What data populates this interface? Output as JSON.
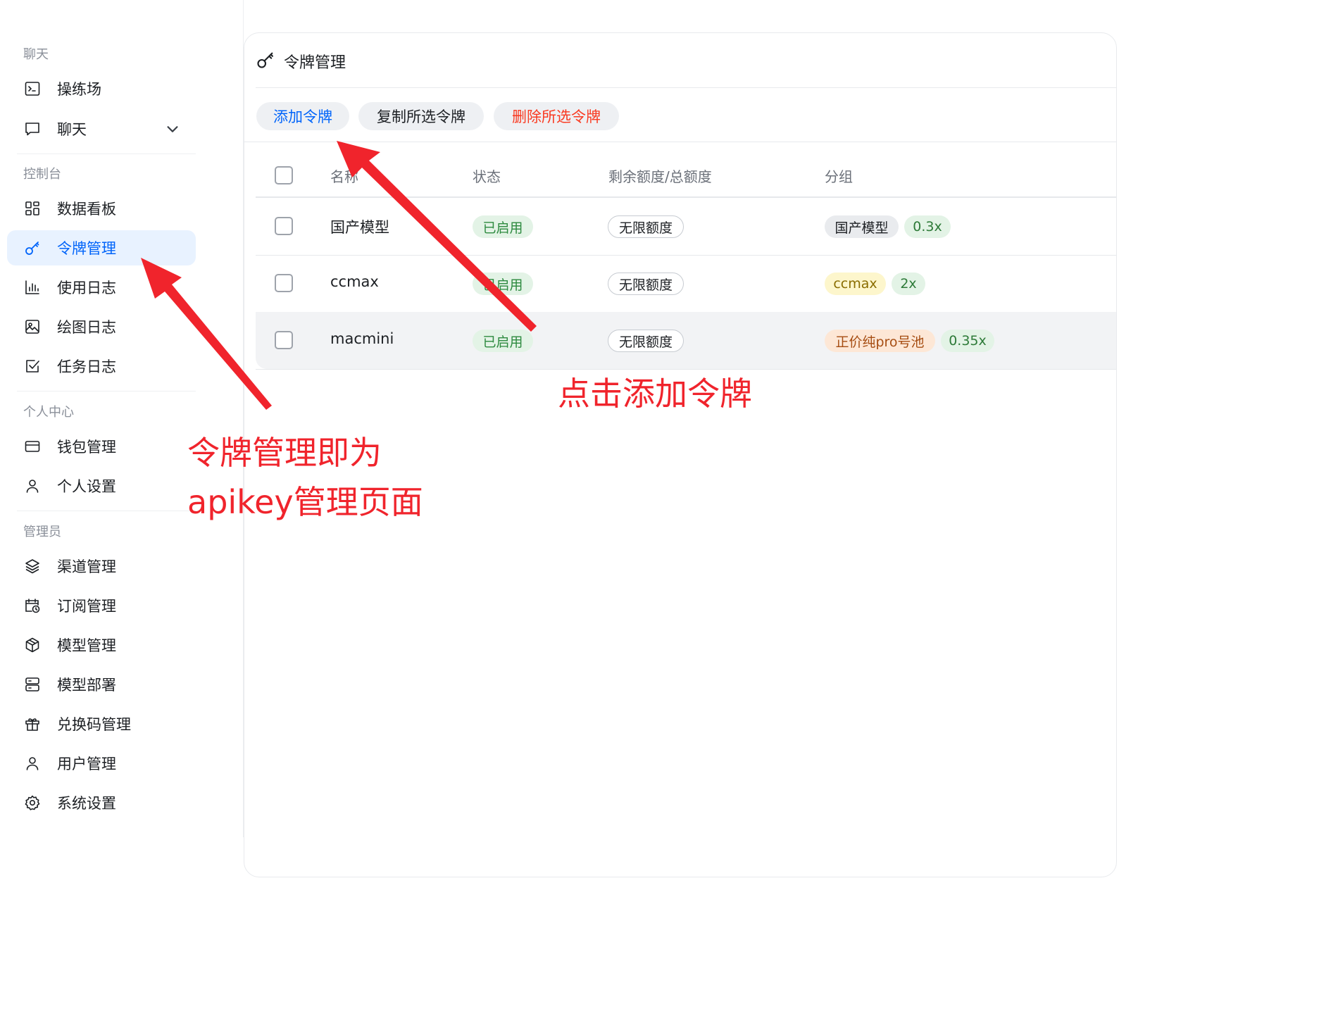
{
  "sidebar": {
    "sections": [
      {
        "label": "聊天"
      },
      {
        "label": "控制台"
      },
      {
        "label": "个人中心"
      },
      {
        "label": "管理员"
      }
    ],
    "items": {
      "playground": {
        "label": "操练场",
        "icon": "terminal-icon"
      },
      "chat": {
        "label": "聊天",
        "icon": "chat-bubble-icon"
      },
      "dashboard": {
        "label": "数据看板",
        "icon": "grid-icon"
      },
      "tokens": {
        "label": "令牌管理",
        "icon": "key-icon",
        "active": true
      },
      "usage_log": {
        "label": "使用日志",
        "icon": "bar-chart-icon"
      },
      "draw_log": {
        "label": "绘图日志",
        "icon": "image-icon"
      },
      "task_log": {
        "label": "任务日志",
        "icon": "checkbox-icon"
      },
      "wallet": {
        "label": "钱包管理",
        "icon": "credit-card-icon"
      },
      "profile": {
        "label": "个人设置",
        "icon": "user-icon"
      },
      "channels": {
        "label": "渠道管理",
        "icon": "layers-icon"
      },
      "subscriptions": {
        "label": "订阅管理",
        "icon": "calendar-icon"
      },
      "models": {
        "label": "模型管理",
        "icon": "cube-icon"
      },
      "deploy": {
        "label": "模型部署",
        "icon": "server-icon"
      },
      "redeem": {
        "label": "兑换码管理",
        "icon": "gift-icon"
      },
      "users": {
        "label": "用户管理",
        "icon": "user-icon"
      },
      "settings": {
        "label": "系统设置",
        "icon": "gear-icon"
      }
    }
  },
  "card": {
    "title": "令牌管理",
    "title_icon": "key-icon",
    "buttons": {
      "add": "添加令牌",
      "copy": "复制所选令牌",
      "delete": "删除所选令牌"
    }
  },
  "table": {
    "columns": [
      "名称",
      "状态",
      "剩余额度/总额度",
      "分组"
    ],
    "rows": [
      {
        "name": "国产模型",
        "status": "已启用",
        "quota": "无限额度",
        "group": "国产模型",
        "ratio": "0.3x"
      },
      {
        "name": "ccmax",
        "status": "已启用",
        "quota": "无限额度",
        "group": "ccmax",
        "ratio": "2x"
      },
      {
        "name": "macmini",
        "status": "已启用",
        "quota": "无限额度",
        "group": "正价纯pro号池",
        "ratio": "0.35x"
      }
    ]
  },
  "annotations": {
    "click_add": "点击添加令牌",
    "token_line1": "令牌管理即为",
    "token_line2": "apikey管理页面"
  },
  "colors": {
    "accent": "#0064fa",
    "danger": "#f93920",
    "annotation": "#f0242c",
    "enabled_tag": "#e3f3e6"
  }
}
